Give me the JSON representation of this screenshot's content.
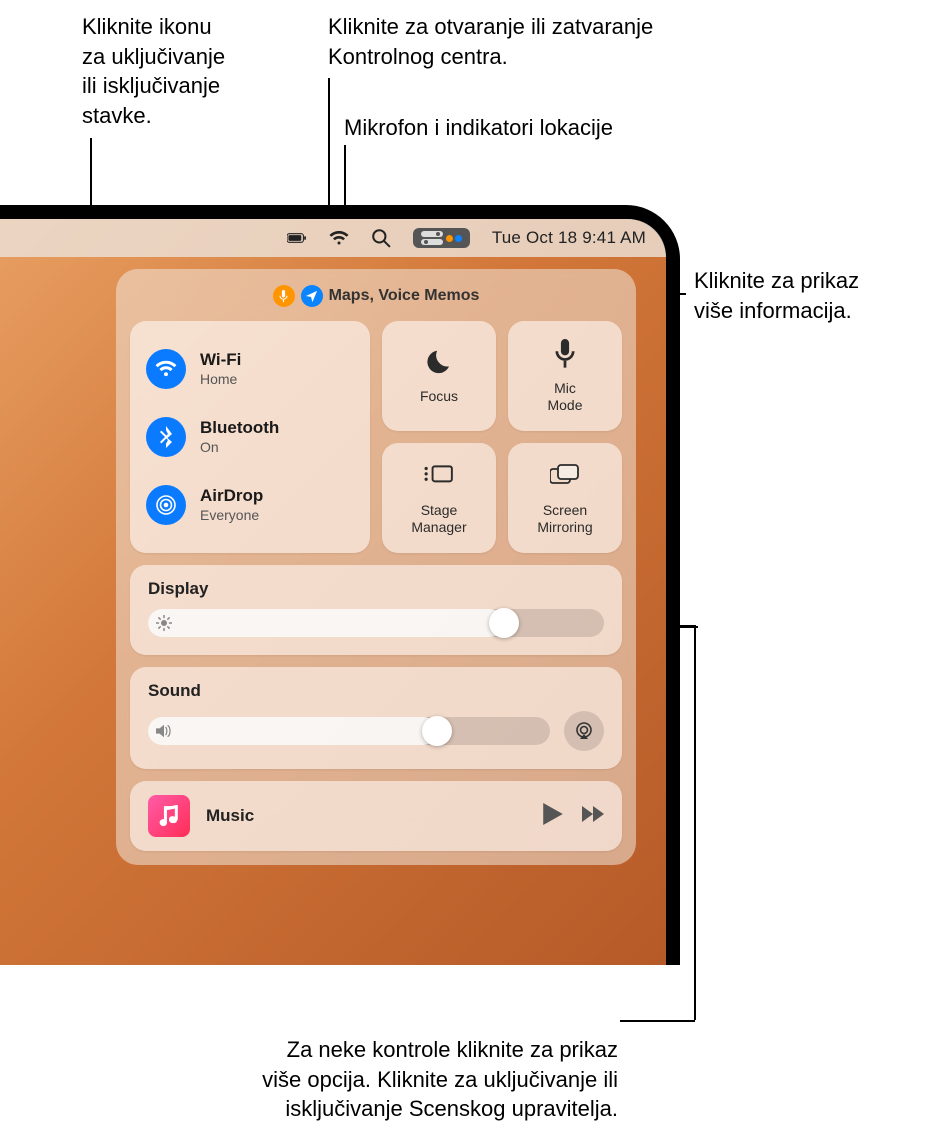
{
  "callouts": {
    "toggle_item": "Kliknite ikonu\nza uključivanje\nili isključivanje\nstavke.",
    "open_close_cc": "Kliknite za otvaranje ili zatvaranje\nKontrolnog centra.",
    "mic_loc_indicators": "Mikrofon i indikatori lokacije",
    "more_info": "Kliknite za prikaz\nviše informacija.",
    "more_options": "Za neke kontrole kliknite za prikaz\nviše opcija. Kliknite za uključivanje ili\nisključivanje Scenskog upravitelja."
  },
  "menubar": {
    "datetime": "Tue Oct 18  9:41 AM"
  },
  "status_pill": {
    "text": "Maps, Voice Memos"
  },
  "connectivity": {
    "wifi": {
      "title": "Wi-Fi",
      "sub": "Home"
    },
    "bluetooth": {
      "title": "Bluetooth",
      "sub": "On"
    },
    "airdrop": {
      "title": "AirDrop",
      "sub": "Everyone"
    }
  },
  "tiles": {
    "focus": "Focus",
    "micmode": "Mic\nMode",
    "stage": "Stage\nManager",
    "mirror": "Screen\nMirroring"
  },
  "sections": {
    "display": "Display",
    "sound": "Sound"
  },
  "music": {
    "title": "Music"
  },
  "sliders": {
    "display_percent": 78,
    "sound_percent": 72
  }
}
